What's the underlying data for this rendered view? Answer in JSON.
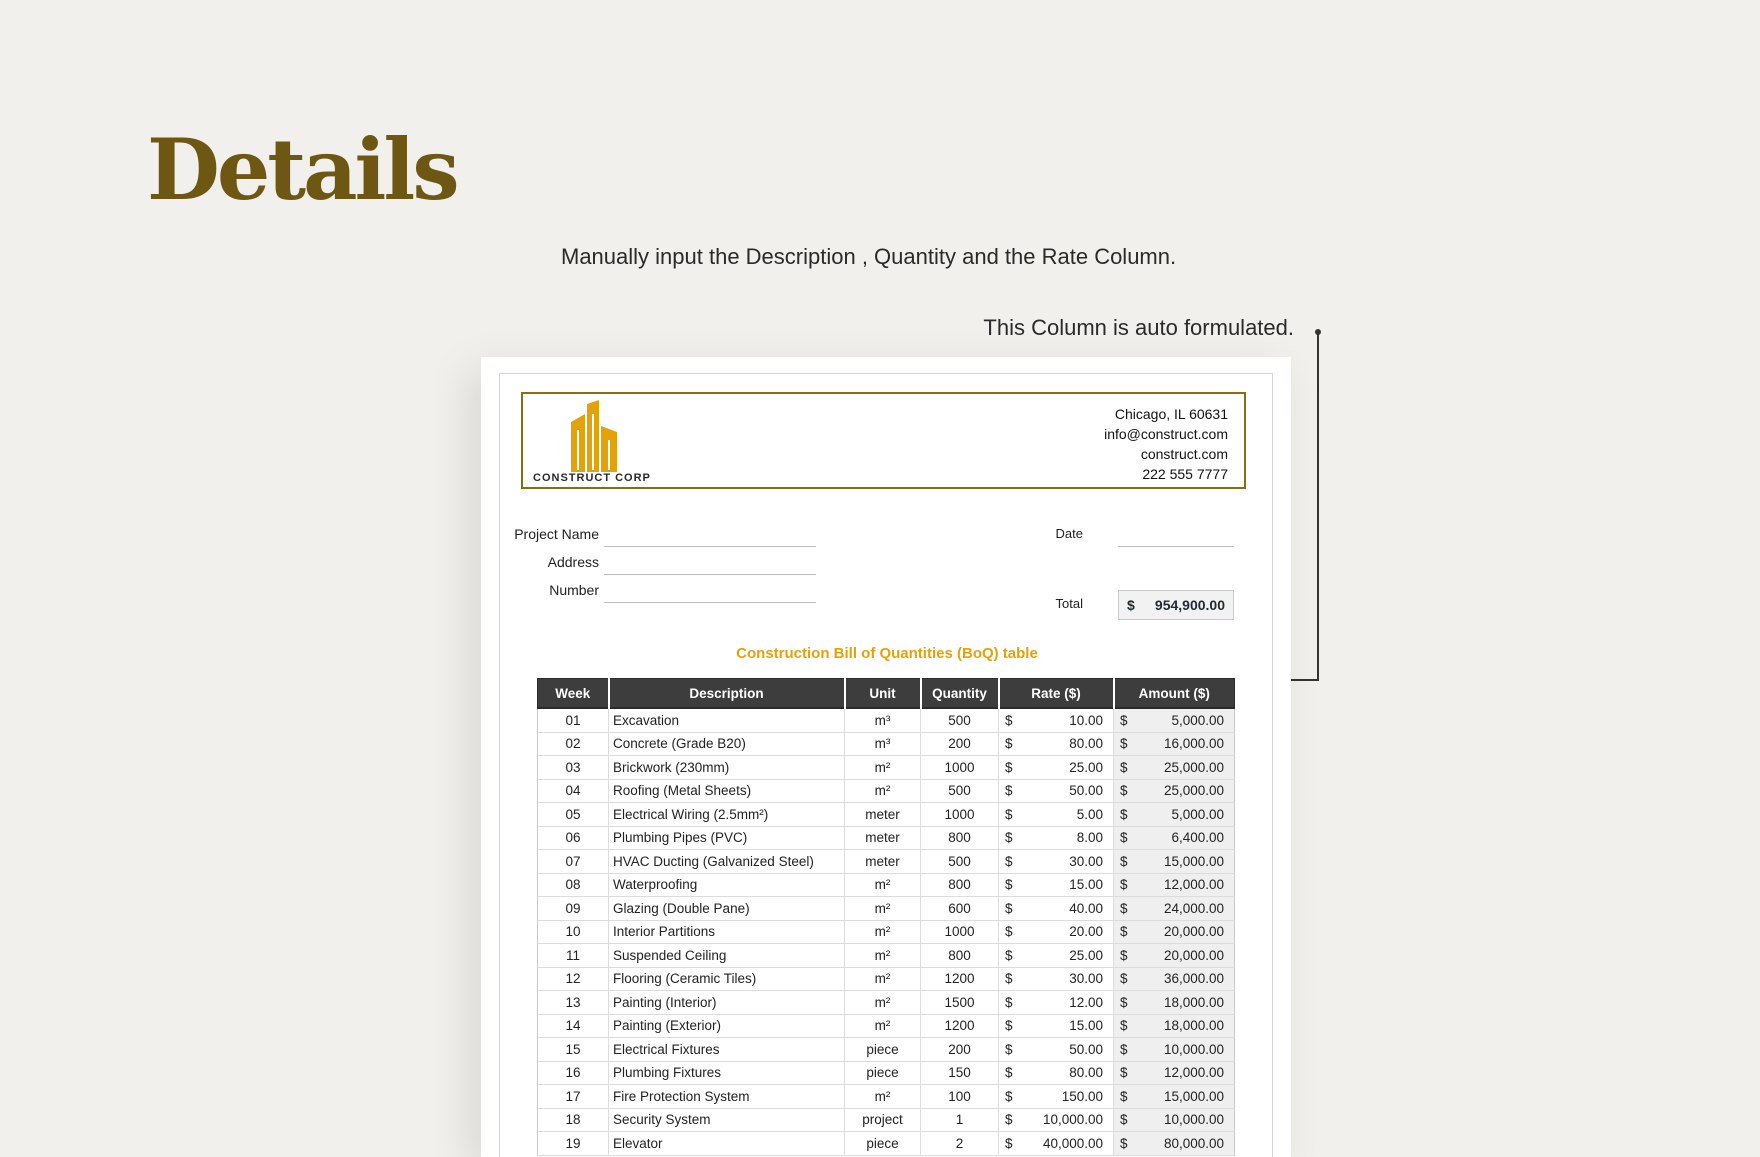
{
  "page": {
    "title": "Details",
    "note_manual": "Manually input the Description , Quantity and the Rate Column.",
    "note_auto": "This Column is auto formulated."
  },
  "document": {
    "company": {
      "name": "CONSTRUCT CORP",
      "logo_icon": "buildings-logo-icon",
      "logo_color": "#e3a20a",
      "border_color": "#8a6d12",
      "city": "Chicago, IL 60631",
      "email": "info@construct.com",
      "website": "construct.com",
      "phone": "222 555 7777"
    },
    "fields": {
      "project_name_label": "Project Name",
      "address_label": "Address",
      "number_label": "Number",
      "date_label": "Date",
      "total_label": "Total",
      "total_currency": "$",
      "total_value": "954,900.00"
    },
    "table": {
      "title": "Construction Bill of Quantities (BoQ) table",
      "headers": [
        "Week",
        "Description",
        "Unit",
        "Quantity",
        "Rate ($)",
        "Amount ($)"
      ],
      "currency": "$",
      "rows": [
        {
          "week": "01",
          "description": "Excavation",
          "unit": "m³",
          "quantity": "500",
          "rate": "10.00",
          "amount": "5,000.00"
        },
        {
          "week": "02",
          "description": "Concrete (Grade B20)",
          "unit": "m³",
          "quantity": "200",
          "rate": "80.00",
          "amount": "16,000.00"
        },
        {
          "week": "03",
          "description": "Brickwork (230mm)",
          "unit": "m²",
          "quantity": "1000",
          "rate": "25.00",
          "amount": "25,000.00"
        },
        {
          "week": "04",
          "description": "Roofing (Metal Sheets)",
          "unit": "m²",
          "quantity": "500",
          "rate": "50.00",
          "amount": "25,000.00"
        },
        {
          "week": "05",
          "description": "Electrical Wiring (2.5mm²)",
          "unit": "meter",
          "quantity": "1000",
          "rate": "5.00",
          "amount": "5,000.00"
        },
        {
          "week": "06",
          "description": "Plumbing Pipes (PVC)",
          "unit": "meter",
          "quantity": "800",
          "rate": "8.00",
          "amount": "6,400.00"
        },
        {
          "week": "07",
          "description": "HVAC Ducting (Galvanized Steel)",
          "unit": "meter",
          "quantity": "500",
          "rate": "30.00",
          "amount": "15,000.00"
        },
        {
          "week": "08",
          "description": "Waterproofing",
          "unit": "m²",
          "quantity": "800",
          "rate": "15.00",
          "amount": "12,000.00"
        },
        {
          "week": "09",
          "description": "Glazing (Double Pane)",
          "unit": "m²",
          "quantity": "600",
          "rate": "40.00",
          "amount": "24,000.00"
        },
        {
          "week": "10",
          "description": "Interior Partitions",
          "unit": "m²",
          "quantity": "1000",
          "rate": "20.00",
          "amount": "20,000.00"
        },
        {
          "week": "11",
          "description": "Suspended Ceiling",
          "unit": "m²",
          "quantity": "800",
          "rate": "25.00",
          "amount": "20,000.00"
        },
        {
          "week": "12",
          "description": "Flooring (Ceramic Tiles)",
          "unit": "m²",
          "quantity": "1200",
          "rate": "30.00",
          "amount": "36,000.00"
        },
        {
          "week": "13",
          "description": "Painting (Interior)",
          "unit": "m²",
          "quantity": "1500",
          "rate": "12.00",
          "amount": "18,000.00"
        },
        {
          "week": "14",
          "description": "Painting (Exterior)",
          "unit": "m²",
          "quantity": "1200",
          "rate": "15.00",
          "amount": "18,000.00"
        },
        {
          "week": "15",
          "description": "Electrical Fixtures",
          "unit": "piece",
          "quantity": "200",
          "rate": "50.00",
          "amount": "10,000.00"
        },
        {
          "week": "16",
          "description": "Plumbing Fixtures",
          "unit": "piece",
          "quantity": "150",
          "rate": "80.00",
          "amount": "12,000.00"
        },
        {
          "week": "17",
          "description": "Fire Protection System",
          "unit": "m²",
          "quantity": "100",
          "rate": "150.00",
          "amount": "15,000.00"
        },
        {
          "week": "18",
          "description": "Security System",
          "unit": "project",
          "quantity": "1",
          "rate": "10,000.00",
          "amount": "10,000.00"
        },
        {
          "week": "19",
          "description": "Elevator",
          "unit": "piece",
          "quantity": "2",
          "rate": "40,000.00",
          "amount": "80,000.00"
        }
      ]
    }
  }
}
